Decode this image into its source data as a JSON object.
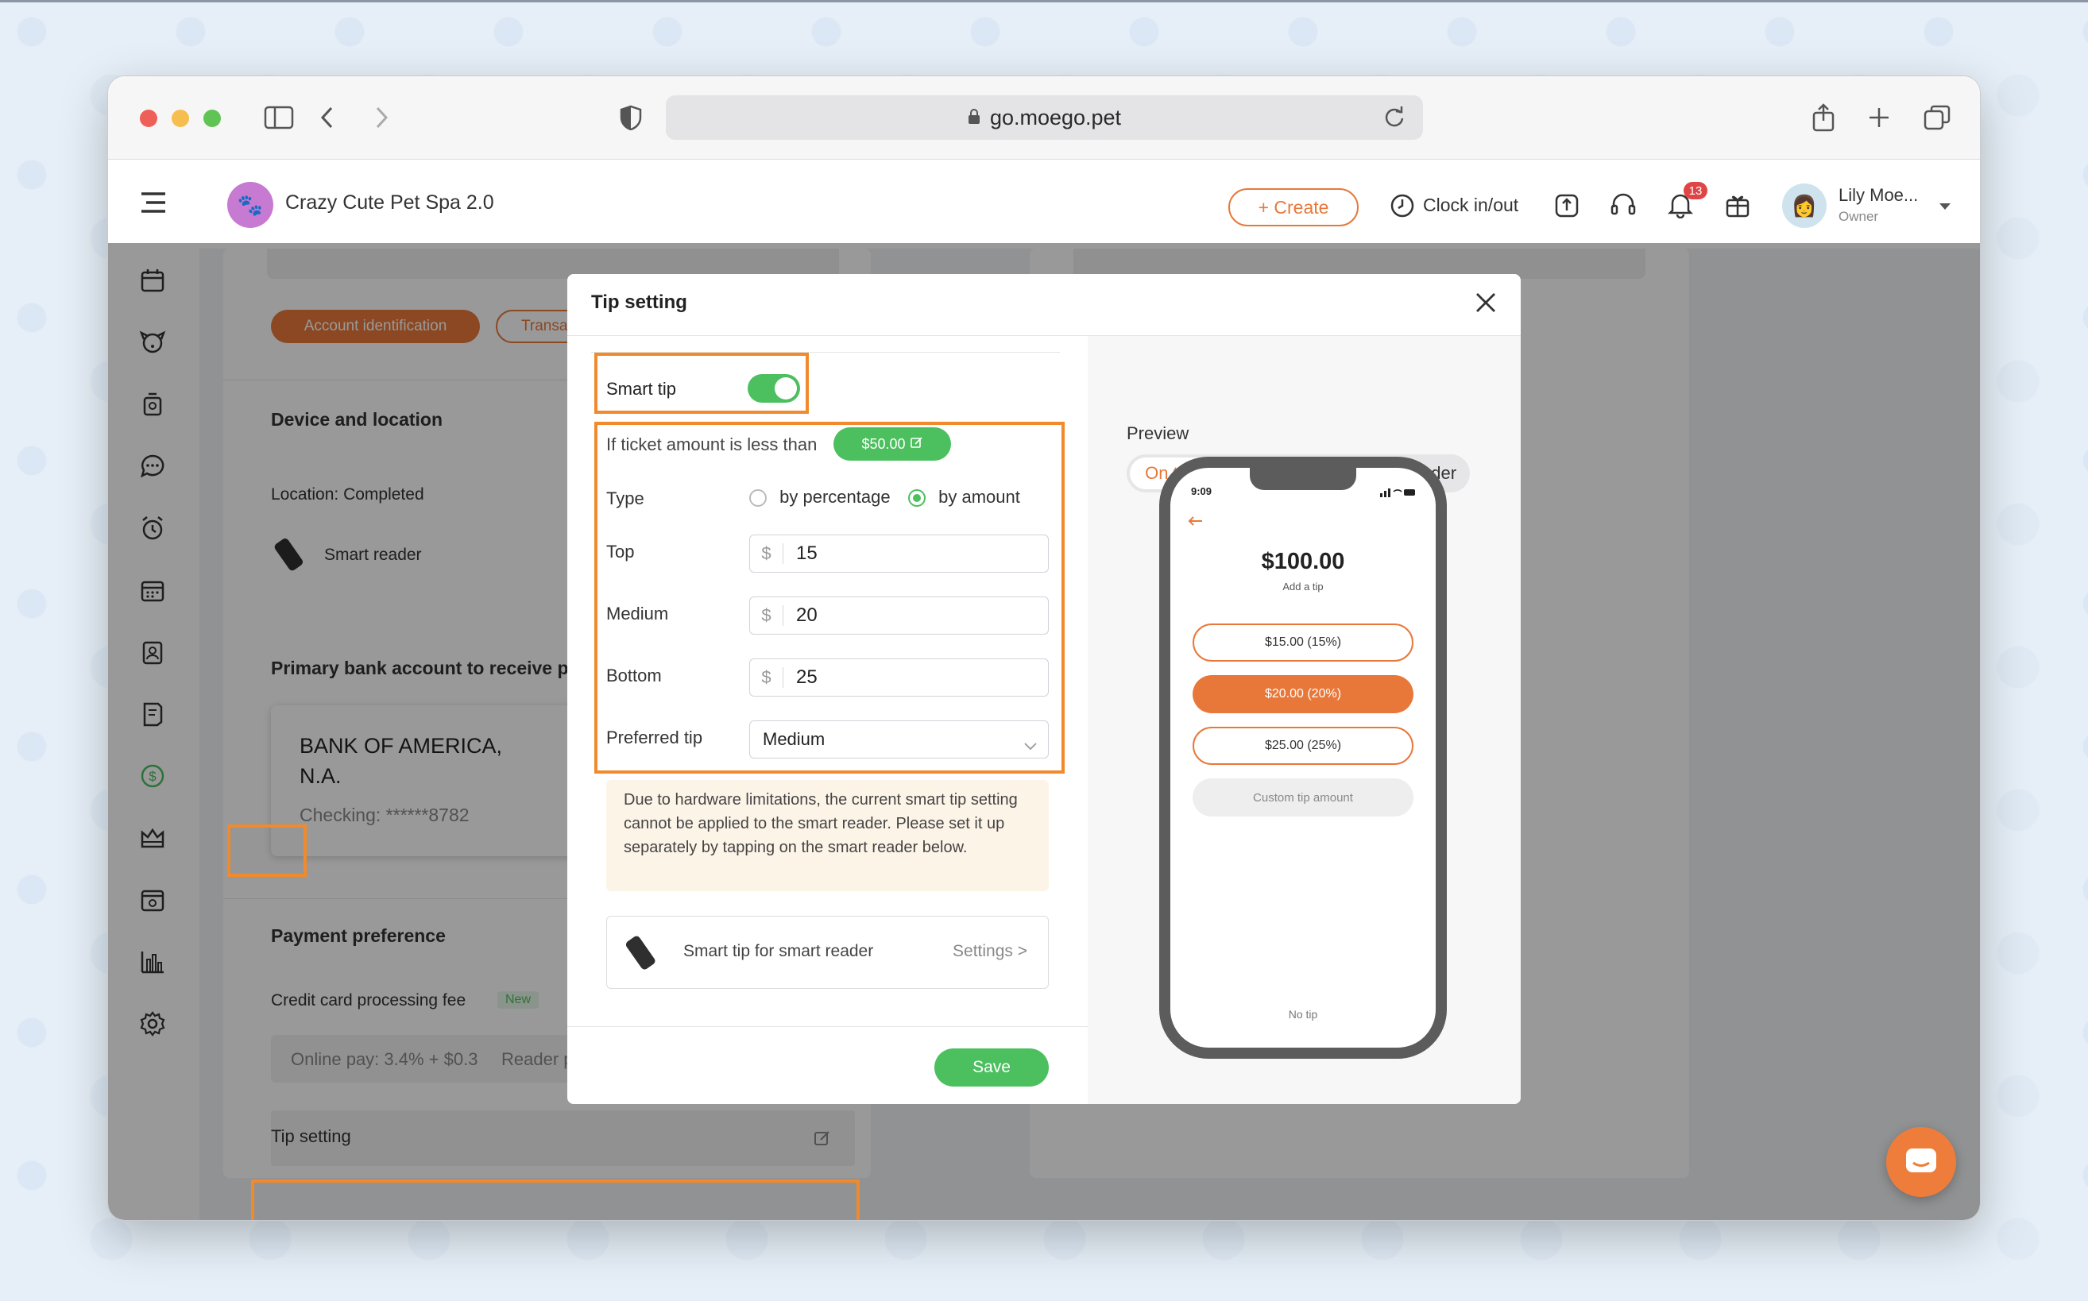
{
  "browser": {
    "url": "go.moego.pet"
  },
  "header": {
    "business_name": "Crazy Cute Pet Spa 2.0",
    "create_label": "+ Create",
    "clock_label": "Clock in/out",
    "notif_count": "13",
    "user_name": "Lily Moe...",
    "user_role": "Owner"
  },
  "page": {
    "tab_active": "Account identification",
    "tab_partial": "Transa",
    "device_title": "Device and location",
    "location_label": "Location: Completed",
    "smart_reader_label": "Smart reader",
    "bank_title": "Primary bank account to receive p",
    "bank_name": "BANK OF AMERICA, N.A.",
    "bank_checking": "Checking: ******8782",
    "payment_pref_title": "Payment preference",
    "cc_fee_label": "Credit card processing fee",
    "new_badge": "New",
    "online_pay": "Online pay: 3.4% + $0.3",
    "reader_partial": "Reader p",
    "tip_setting_label": "Tip setting"
  },
  "modal": {
    "title": "Tip setting",
    "smart_tip_label": "Smart tip",
    "smart_tip_on": true,
    "threshold_label": "If ticket amount is less than",
    "threshold_value": "$50.00",
    "type_label": "Type",
    "type_options": [
      "by percentage",
      "by amount"
    ],
    "type_selected": "by amount",
    "top_label": "Top",
    "top_value": "15",
    "medium_label": "Medium",
    "medium_value": "20",
    "bottom_label": "Bottom",
    "bottom_value": "25",
    "currency": "$",
    "preferred_label": "Preferred tip",
    "preferred_value": "Medium",
    "notice": "Due to hardware limitations, the current smart tip setting cannot be applied to the smart reader. Please set it up separately by tapping on the smart reader below.",
    "reader_row_label": "Smart tip for smart reader",
    "reader_row_link": "Settings >",
    "save_label": "Save"
  },
  "preview": {
    "title": "Preview",
    "tabs": [
      "On the invoice page",
      "On smart reader"
    ],
    "active_tab": "On the invoice page",
    "phone_time": "9:09",
    "amount": "$100.00",
    "add_tip": "Add a tip",
    "options": [
      "$15.00 (15%)",
      "$20.00 (20%)",
      "$25.00 (25%)"
    ],
    "selected_option": "$20.00 (20%)",
    "custom_label": "Custom tip amount",
    "no_tip": "No tip"
  },
  "colors": {
    "accent": "#e8783a",
    "green": "#4cbf5f",
    "highlight": "#f08a2c"
  }
}
